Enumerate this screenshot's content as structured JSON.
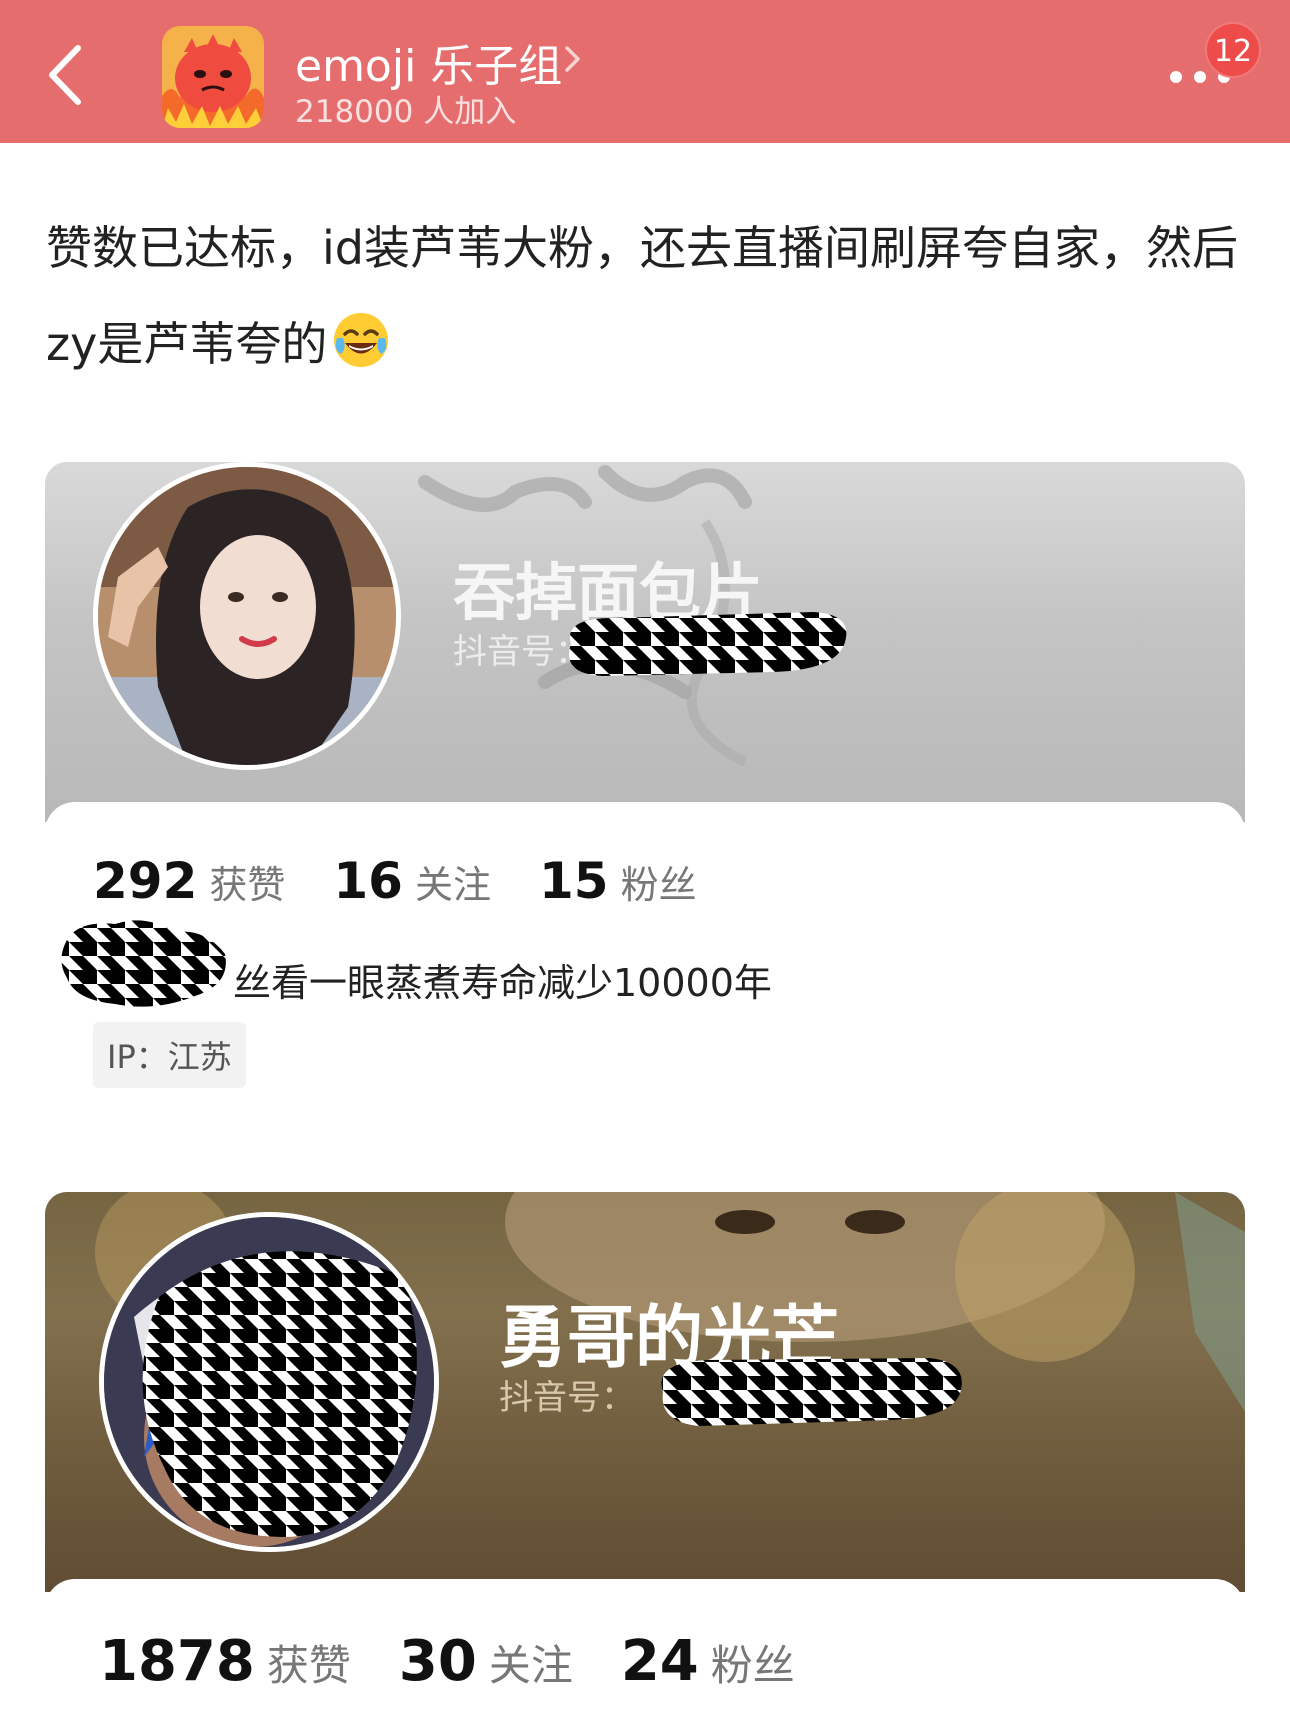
{
  "header": {
    "group_name": "emoji 乐子组",
    "member_count": "218000 人加入",
    "badge_count": "12"
  },
  "post": {
    "text": "赞数已达标，id装芦苇大粉，还去直播间刷屏夸自家，然后zy是芦苇夸的",
    "emoji": "😂"
  },
  "profiles": [
    {
      "nickname": "吞掉面包片",
      "handle_label": "抖音号：c",
      "stats": [
        {
          "num": "292",
          "label": "获赞"
        },
        {
          "num": "16",
          "label": "关注"
        },
        {
          "num": "15",
          "label": "粉丝"
        }
      ],
      "bio_visible": "丝看一眼蒸煮寿命减少10000年",
      "ip": "IP：江苏"
    },
    {
      "nickname": "勇哥的光芒",
      "handle_label": "抖音号：",
      "stats": [
        {
          "num": "1878",
          "label": "获赞"
        },
        {
          "num": "30",
          "label": "关注"
        },
        {
          "num": "24",
          "label": "粉丝"
        }
      ]
    }
  ],
  "colors": {
    "header_bg": "#e56d6d",
    "badge_bg": "#ee4b4b"
  }
}
